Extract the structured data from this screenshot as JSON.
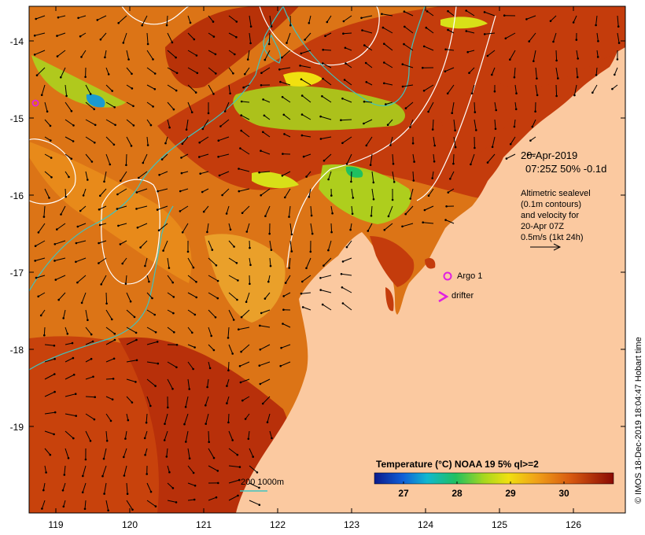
{
  "map": {
    "date_line": "20-Apr-2019",
    "time_line": "07:25Z  50% -0.1d",
    "legend_lines": [
      "Altimetric sealevel",
      "(0.1m contours)",
      "and velocity for",
      "20-Apr 07Z",
      "0.5m/s (1kt 24h)"
    ],
    "argo_label": "Argo 1",
    "drifter_label": "drifter",
    "isobath_label": "200  1000m",
    "credit": "© IMOS 18-Dec-2019 18:04:47 Hobart time",
    "lat_ticks": [
      "-14",
      "-15",
      "-16",
      "-17",
      "-18",
      "-19"
    ],
    "lon_ticks": [
      "119",
      "120",
      "121",
      "122",
      "123",
      "124",
      "125",
      "126"
    ],
    "colorbar": {
      "title": "Temperature (°C) NOAA 19 5% ql>=2",
      "ticks": [
        "27",
        "28",
        "29",
        "30"
      ],
      "range": [
        26.5,
        31
      ]
    },
    "colors": {
      "land": "#fbc9a0",
      "sst_warm": "#c23a0c",
      "sst_mid": "#e07a14",
      "sst_cool": "#a8d81e",
      "contour": "#ffffff",
      "isobath": "#3fc4c0",
      "marker": "#e020e0"
    }
  }
}
